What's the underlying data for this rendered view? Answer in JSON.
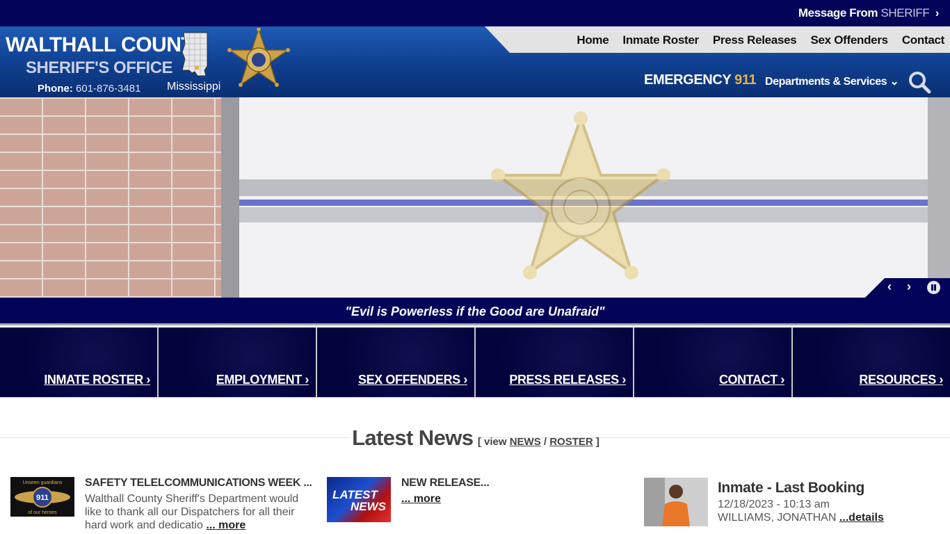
{
  "topbar": {
    "message_label": "Message From",
    "message_highlight": "SHERIFF",
    "chevron": "›"
  },
  "header": {
    "title_line1": "WALTHALL COUNTY",
    "title_line2": "SHERIFF'S OFFICE",
    "phone_label": "Phone:",
    "phone_number": "601-876-3481",
    "state_label": "Mississippi",
    "emergency_label": "EMERGENCY",
    "emergency_number": "911",
    "departments_label": "Departments & Services",
    "chevron_down": "⌄"
  },
  "nav": {
    "items": [
      {
        "label": "Home"
      },
      {
        "label": "Inmate Roster"
      },
      {
        "label": "Press Releases"
      },
      {
        "label": "Sex Offenders"
      },
      {
        "label": "Contact"
      }
    ]
  },
  "hero": {
    "prev": "‹",
    "next": "›",
    "quote": "\"Evil is Powerless if the Good are Unafraid\""
  },
  "tiles": {
    "items": [
      {
        "label": "INMATE ROSTER ›"
      },
      {
        "label": "EMPLOYMENT ›"
      },
      {
        "label": "SEX OFFENDERS ›"
      },
      {
        "label": "PRESS RELEASES ›"
      },
      {
        "label": "CONTACT ›"
      },
      {
        "label": "RESOURCES ›"
      }
    ]
  },
  "latest": {
    "title": "Latest News",
    "bracket_open": "[ view",
    "news_link": "NEWS",
    "separator": "/",
    "roster_link": "ROSTER",
    "bracket_close": "]"
  },
  "news": {
    "items": [
      {
        "title": "SAFETY TELELCOMMUNICATIONS WEEK ...",
        "body": "Walthall County Sheriff's Department would like to thank all our Dispatchers for all their hard work and dedicatio",
        "more": "... more"
      },
      {
        "title": "NEW RELEASE...",
        "body": "",
        "more": "... more"
      }
    ],
    "thumb1_text_top": "Unseen guardians",
    "thumb1_text_mid": "911",
    "thumb1_text_bottom": "of our heroes",
    "thumb2_text_1": "LATEST",
    "thumb2_text_2": "NEWS"
  },
  "inmate": {
    "title": "Inmate - Last Booking",
    "date": "12/18/2023 - 10:13 am",
    "name": "WILLIAMS, JONATHAN",
    "details": "...details"
  },
  "colors": {
    "navy": "#03035a",
    "header_blue": "#1f5bb5",
    "accent_gold": "#e2b24a"
  }
}
